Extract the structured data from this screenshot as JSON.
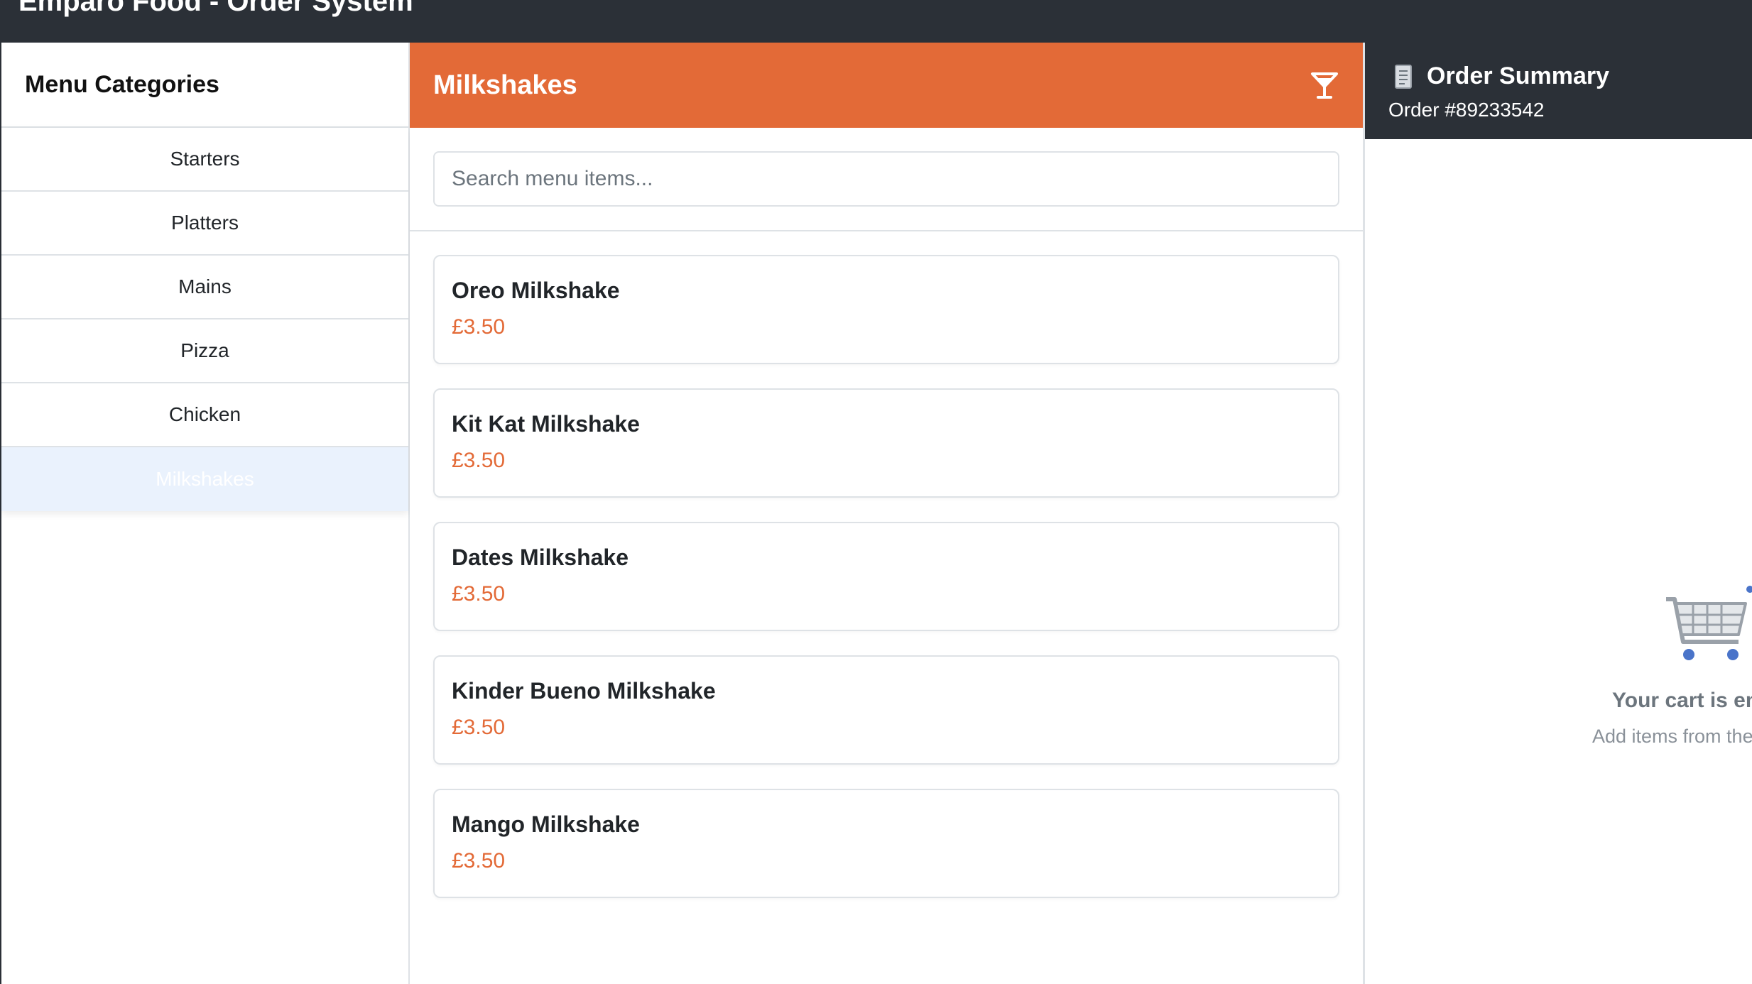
{
  "app": {
    "title": "Emparo Food - Order System"
  },
  "sidebar": {
    "title": "Menu Categories",
    "categories": [
      {
        "label": "Starters",
        "active": false
      },
      {
        "label": "Platters",
        "active": false
      },
      {
        "label": "Mains",
        "active": false
      },
      {
        "label": "Pizza",
        "active": false
      },
      {
        "label": "Chicken",
        "active": false
      },
      {
        "label": "Milkshakes",
        "active": true
      }
    ]
  },
  "main": {
    "title": "Milkshakes",
    "header_icon": "cocktail-icon",
    "search": {
      "placeholder": "Search menu items...",
      "value": ""
    },
    "items": [
      {
        "name": "Oreo Milkshake",
        "price": "£3.50"
      },
      {
        "name": "Kit Kat Milkshake",
        "price": "£3.50"
      },
      {
        "name": "Dates Milkshake",
        "price": "£3.50"
      },
      {
        "name": "Kinder Bueno Milkshake",
        "price": "£3.50"
      },
      {
        "name": "Mango Milkshake",
        "price": "£3.50"
      }
    ]
  },
  "order": {
    "title": "Order Summary",
    "number": "Order #89233542",
    "icon": "receipt-icon",
    "empty_icon": "shopping-cart-icon",
    "empty_title": "Your cart is empty",
    "empty_subtitle": "Add items from the menu"
  },
  "colors": {
    "accent": "#e36a37",
    "dark": "#2b3037",
    "active_category_bg": "#eaf2fd"
  }
}
